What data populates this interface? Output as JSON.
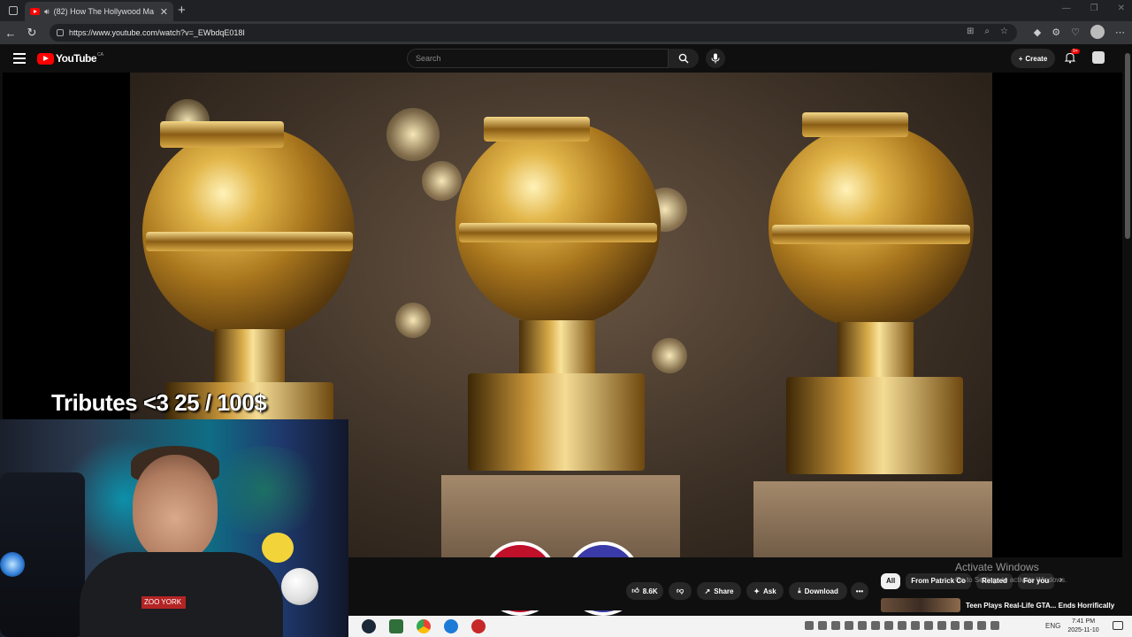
{
  "browser": {
    "tab_title": "(82) How The Hollywood Ma",
    "tab_close": "✕",
    "new_tab": "+",
    "url": "https://www.youtube.com/watch?v=_EWbdqE018I",
    "nav_back": "←",
    "nav_reload": "↻",
    "win_controls": [
      "—",
      "❐",
      "✕"
    ]
  },
  "youtube": {
    "logo_text": "YouTube",
    "region": "CA",
    "search_placeholder": "Search",
    "create_label": "Create",
    "notification_badge": "9+"
  },
  "overlay": {
    "tributes_text": "Tributes <3  25  / 100$",
    "webcam_shirt_text": "ZOO YORK"
  },
  "actions": {
    "like_count": "8.6K",
    "share_label": "Share",
    "ask_label": "Ask",
    "download_label": "Download",
    "more_label": "•••"
  },
  "chips": [
    "All",
    "From Patrick Co",
    "Related",
    "For you"
  ],
  "related_video": {
    "title": "Teen Plays Real-Life GTA... Ends Horrifically"
  },
  "windows_watermark": {
    "line1": "Activate Windows",
    "line2": "Go to Settings to activate Windows."
  },
  "taskbar": {
    "lang": "ENG",
    "time": "7:41 PM",
    "date": "2025-11-10"
  },
  "colors": {
    "youtube_red": "#ff0000",
    "chrome_dark": "#202124",
    "yt_bg": "#0f0f0f",
    "taskbar": "#f3f3f3"
  }
}
